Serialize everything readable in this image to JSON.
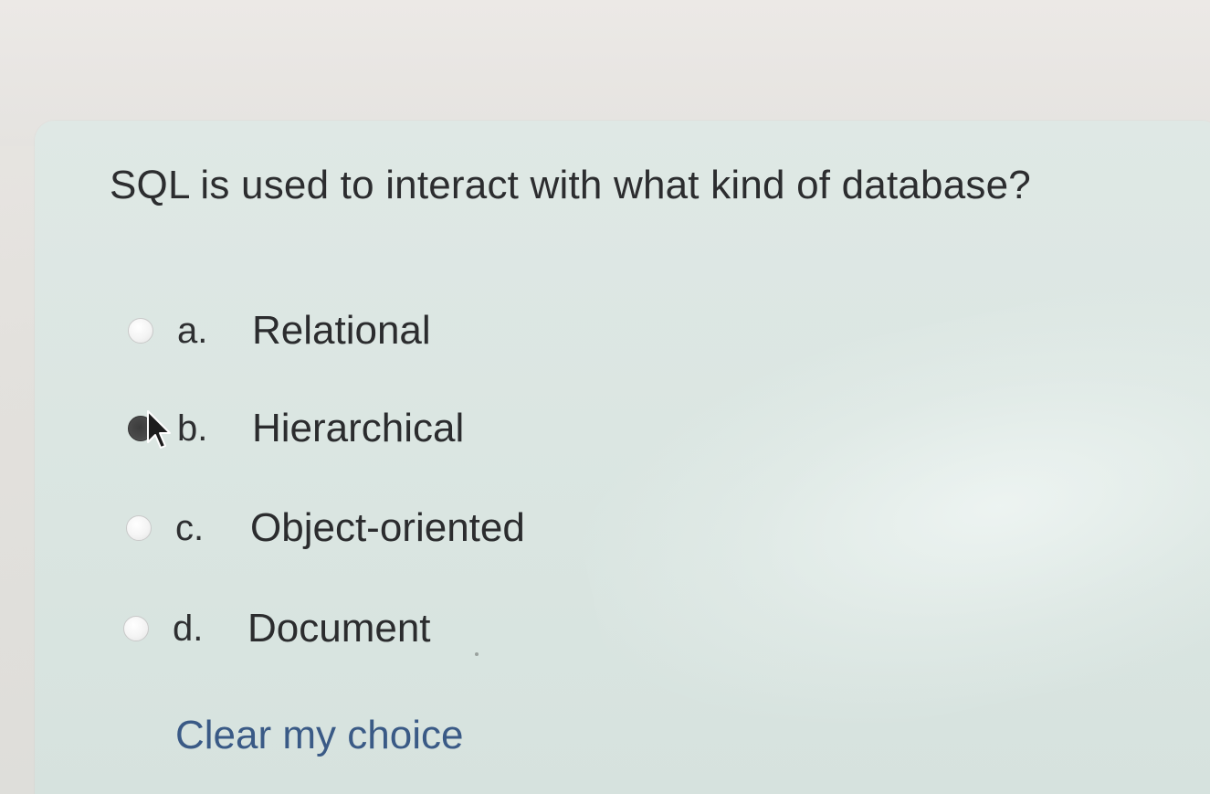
{
  "question": {
    "text": "SQL is used to interact with what kind of database?"
  },
  "options": [
    {
      "letter": "a.",
      "label": "Relational",
      "selected": false
    },
    {
      "letter": "b.",
      "label": "Hierarchical",
      "selected": true
    },
    {
      "letter": "c.",
      "label": "Object-oriented",
      "selected": false
    },
    {
      "letter": "d.",
      "label": "Document",
      "selected": false
    }
  ],
  "clear_choice": {
    "label": "Clear my choice"
  },
  "colors": {
    "card_background": "#dbe6e2",
    "text": "#2c2d2f",
    "link": "#3a5a86",
    "selected_radio": "#3c3c3c"
  },
  "icons": {
    "cursor": "mouse-pointer-icon"
  }
}
